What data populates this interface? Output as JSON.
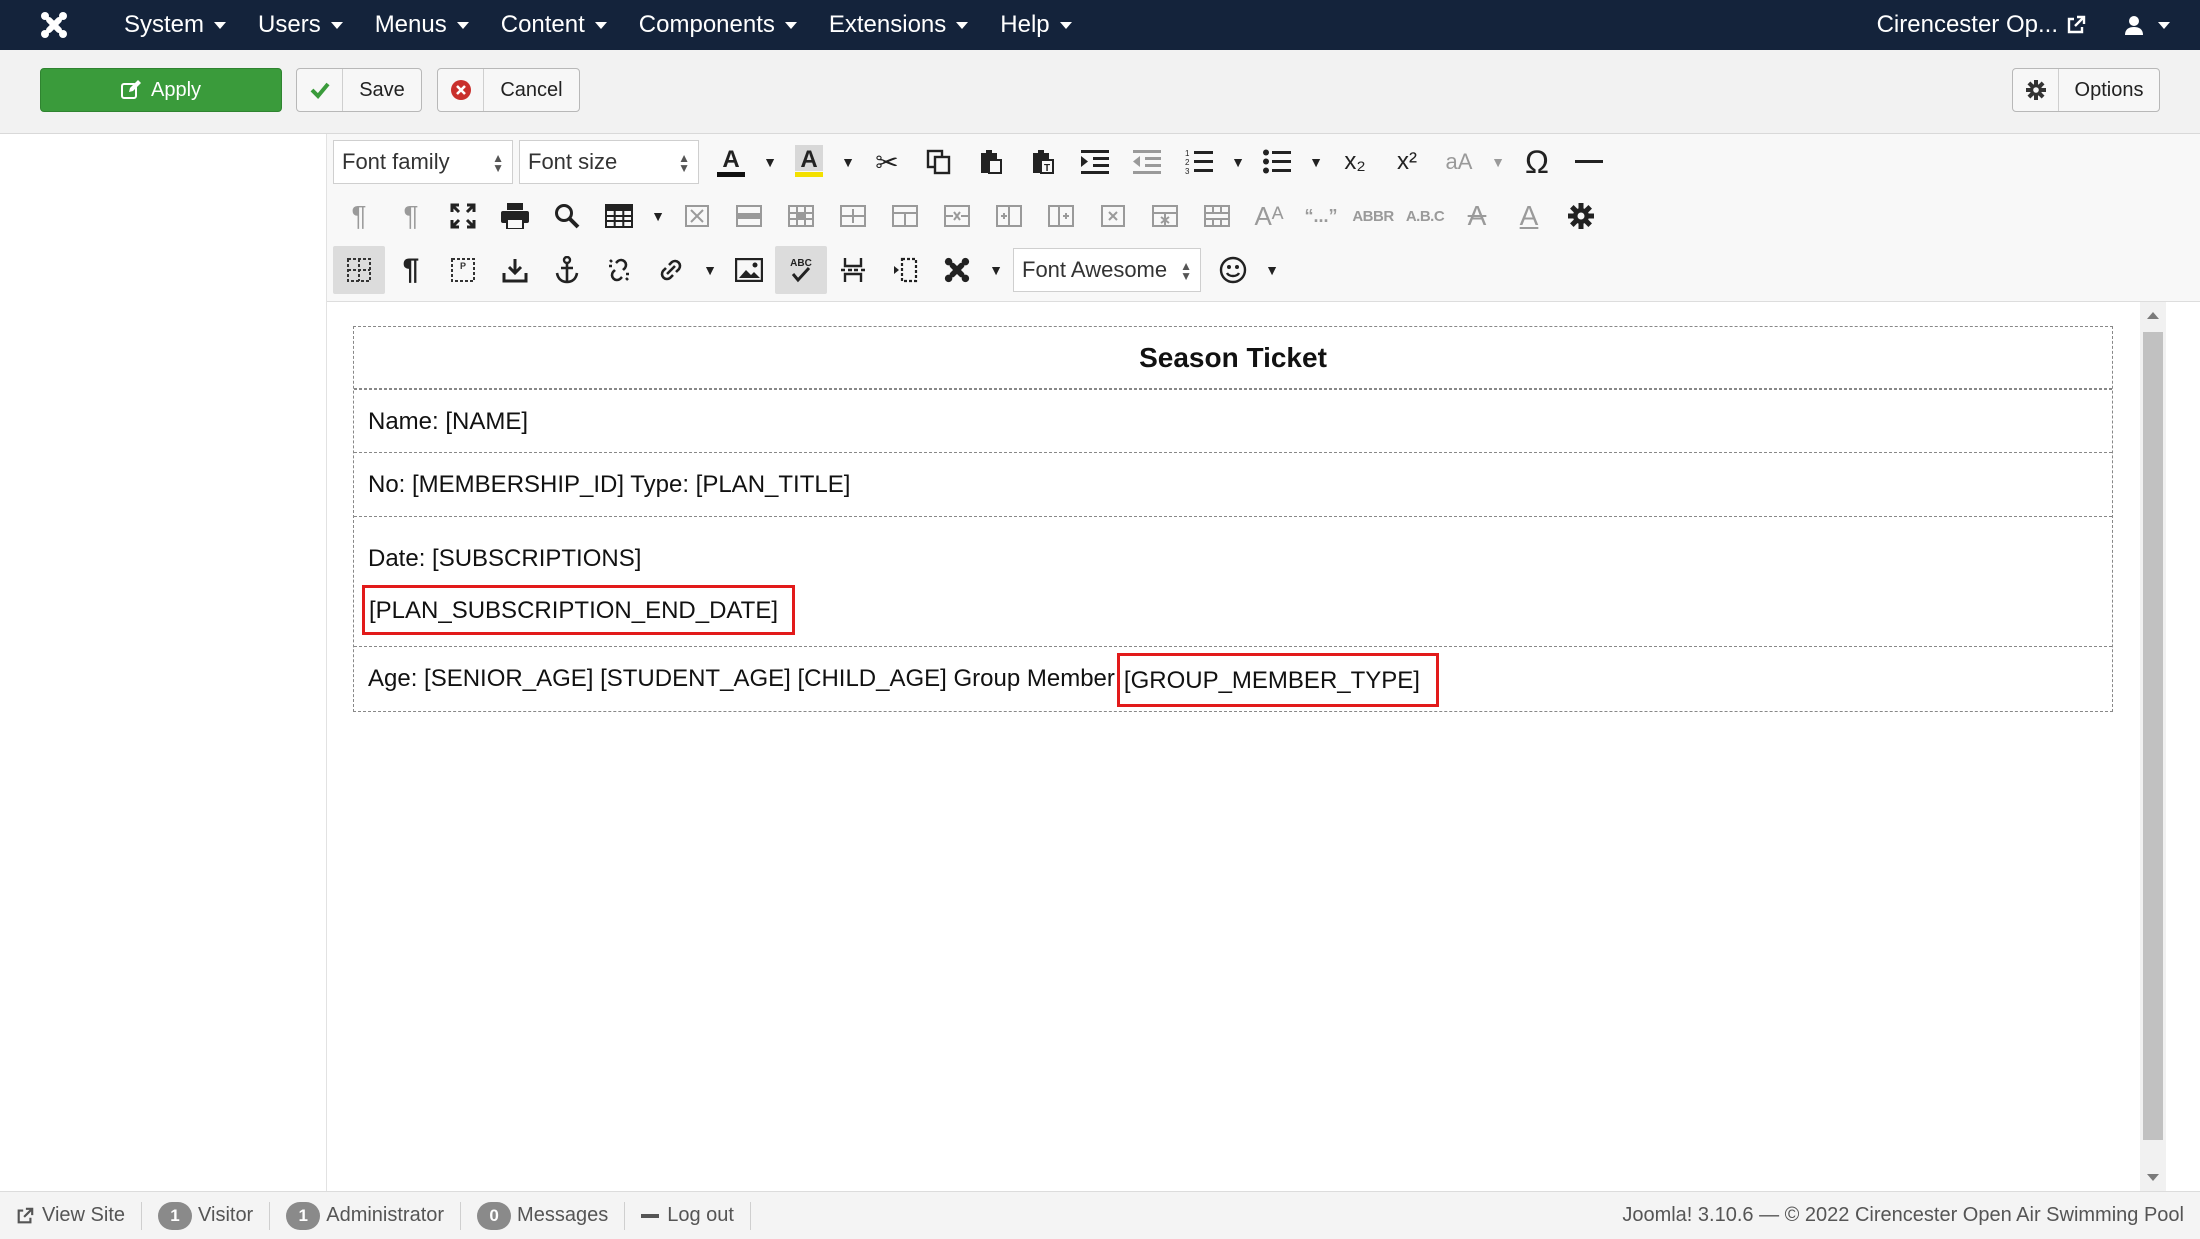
{
  "navbar": {
    "menu": [
      {
        "label": "System"
      },
      {
        "label": "Users"
      },
      {
        "label": "Menus"
      },
      {
        "label": "Content"
      },
      {
        "label": "Components"
      },
      {
        "label": "Extensions"
      },
      {
        "label": "Help"
      }
    ],
    "site_label": "Cirencester Op...",
    "icons": {
      "logo": "joomla-logo-icon",
      "external": "external-link-icon",
      "user": "user-icon"
    }
  },
  "toolbar": {
    "apply_label": "Apply",
    "save_label": "Save",
    "cancel_label": "Cancel",
    "options_label": "Options"
  },
  "editor": {
    "font_family_label": "Font family",
    "font_size_label": "Font size",
    "font_awesome_label": "Font Awesome",
    "special_char_glyph": "Ω",
    "quote_glyph": "“...”",
    "abbr_label": "ABBR",
    "acronym_label": "A.B.C",
    "abc_label": "ABC",
    "subscript_label": "x₂",
    "superscript_label": "x²"
  },
  "document": {
    "title": "Season Ticket",
    "name_line": "Name: [NAME]",
    "no_line": "No: [MEMBERSHIP_ID] Type: [PLAN_TITLE]",
    "date_line": "Date: [SUBSCRIPTIONS]",
    "end_date_tag": "[PLAN_SUBSCRIPTION_END_DATE]",
    "age_line": "Age: [SENIOR_AGE] [STUDENT_AGE] [CHILD_AGE] Group Member",
    "group_member_tag": "[GROUP_MEMBER_TYPE]",
    "highlight_color": "#e21a1a"
  },
  "statusbar": {
    "view_site": "View Site",
    "visitor_count": "1",
    "visitor_label": "Visitor",
    "admin_count": "1",
    "admin_label": "Administrator",
    "messages_count": "0",
    "messages_label": "Messages",
    "logout_label": "Log out",
    "version": "Joomla! 3.10.6  —  © 2022 Cirencester Open Air Swimming Pool"
  },
  "colors": {
    "navbar": "#14233b",
    "apply": "#3a9b3b",
    "cancel_icon": "#c9302c"
  }
}
